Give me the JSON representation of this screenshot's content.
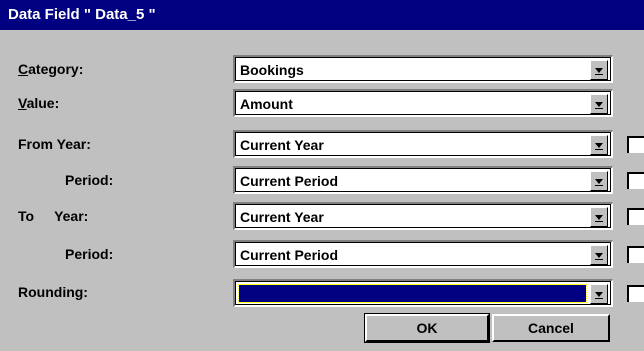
{
  "window": {
    "title": "Data Field \" Data_5 \""
  },
  "fields": {
    "category": {
      "label_underlined": "C",
      "label_rest": "ategory:",
      "value": "Bookings"
    },
    "value": {
      "label_underlined": "V",
      "label_rest": "alue:",
      "value": "Amount"
    },
    "from_year": {
      "label": "From Year:",
      "value": "Current Year"
    },
    "from_period": {
      "label": "Period:",
      "value": "Current Period"
    },
    "to_year": {
      "label_to": "To",
      "label_year": "Year:",
      "value": "Current Year"
    },
    "to_period": {
      "label": "Period:",
      "value": "Current Period"
    },
    "rounding": {
      "label": "Rounding:",
      "value": ""
    }
  },
  "buttons": {
    "ok": "OK",
    "cancel": "Cancel"
  },
  "colors": {
    "titlebar": "#000080",
    "face": "#c0c0c0",
    "selection": "#000080"
  }
}
